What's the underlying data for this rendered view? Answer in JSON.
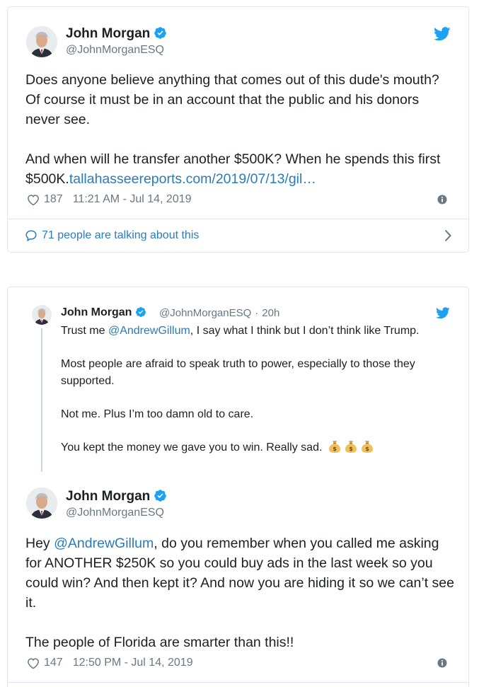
{
  "tweet1": {
    "author_name": "John Morgan",
    "author_handle": "@JohnMorganESQ",
    "verified_icon": "verified-badge-icon",
    "platform_icon": "twitter-bird-icon",
    "text_p1": "Does anyone believe anything that comes out of this dude's mouth? Of course it must be in an account that the public and his donors never see.",
    "text_p2_prefix": "And when will he transfer another $500K? When he spends this first $500K.",
    "text_p2_link": "tallahasseereports.com/2019/07/13/gil…",
    "likes": "187",
    "timestamp": "11:21 AM - Jul 14, 2019",
    "talking": "71 people are talking about this"
  },
  "quoted": {
    "author_name": "John Morgan",
    "author_handle": "@JohnMorganESQ",
    "separator": "·",
    "age": "20h",
    "line1_prefix": "Trust me ",
    "line1_mention": "@AndrewGillum",
    "line1_suffix": ", I say what I think but I don’t think like Trump.",
    "p2": "Most people are afraid to speak truth to power, especially to those they supported.",
    "p3": "Not me. Plus I’m too damn old to care.",
    "p4": "You kept the money we gave you to win. Really sad.",
    "emoji": "money-bag-icon"
  },
  "tweet2": {
    "author_name": "John Morgan",
    "author_handle": "@JohnMorganESQ",
    "text_p1_prefix": "Hey ",
    "text_p1_mention": "@AndrewGillum",
    "text_p1_suffix": ", do you remember when you called me asking for ANOTHER $250K so you could buy ads in the last week so you could win? And then kept it? And now you are hiding it so we can’t see it.",
    "text_p2": "The people of Florida are smarter than this!!",
    "likes": "147",
    "timestamp": "12:50 PM - Jul 14, 2019"
  },
  "colors": {
    "twitter_blue": "#1da1f2",
    "link_blue": "#2b7bb9",
    "secondary_gray": "#697882",
    "border": "#e1e8ed"
  }
}
